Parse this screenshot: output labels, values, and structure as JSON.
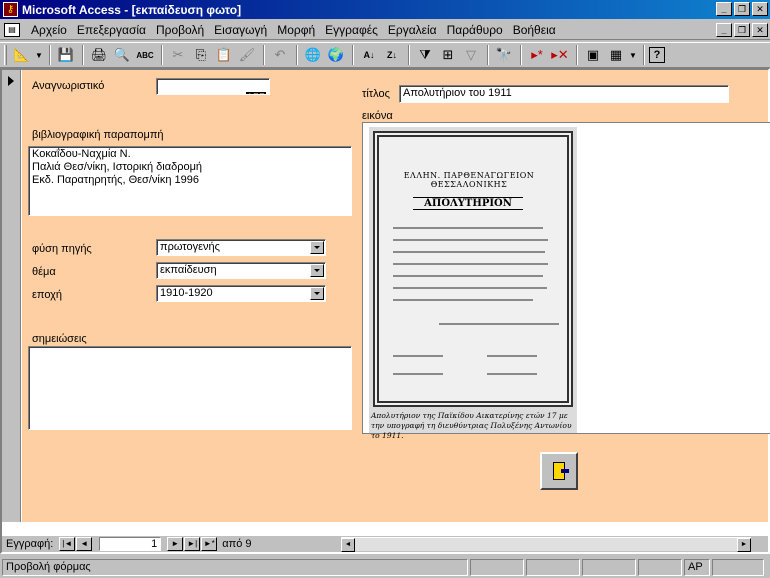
{
  "window": {
    "title": "Microsoft Access - [εκπαίδευση φωτο]",
    "min": "_",
    "restore": "❐",
    "close": "✕"
  },
  "menu": [
    "Αρχείο",
    "Επεξεργασία",
    "Προβολή",
    "Εισαγωγή",
    "Μορφή",
    "Εγγραφές",
    "Εργαλεία",
    "Παράθυρο",
    "Βοήθεια"
  ],
  "toolbar": {
    "icons": [
      "view-design-icon",
      "save-icon",
      "print-icon",
      "print-preview-icon",
      "spelling-icon",
      "cut-icon",
      "copy-icon",
      "paste-icon",
      "format-painter-icon",
      "undo-icon",
      "insert-hyperlink-icon",
      "web-toolbar-icon",
      "sort-ascending-icon",
      "sort-descending-icon",
      "filter-by-selection-icon",
      "filter-by-form-icon",
      "apply-filter-icon",
      "find-icon",
      "new-record-icon",
      "delete-record-icon",
      "database-window-icon",
      "new-object-icon",
      "help-icon"
    ],
    "spelling_label": "ABC"
  },
  "form": {
    "id_label": "Αναγνωριστικό",
    "id_value": "155",
    "title_label": "τίτλος",
    "title_value": "Απολυτήριον του 1911",
    "biblio_label": "βιβλιογραφική παραπομπή",
    "biblio_value": "Κοκαΐδου-Ναχμία Ν.\nΠαλιά Θεσ/νίκη, Ιστορική διαδρομή\nΕκδ. Παρατηρητής, Θεσ/νίκη 1996",
    "source_label": "φύση πηγής",
    "source_value": "πρωτογενής",
    "theme_label": "θέμα",
    "theme_value": "εκπαίδευση",
    "era_label": "εποχή",
    "era_value": "1910-1920",
    "notes_label": "σημειώσεις",
    "notes_value": "",
    "image_label": "εικόνα",
    "photo": {
      "header": "ΕΛΛΗΝ. ΠΑΡΘΕΝΑΓΩΓΕΙΟΝ ΘΕΣΣΑΛΟΝΙΚΗΣ",
      "heading": "ΑΠΟΛΥΤΗΡΙΟΝ",
      "caption": "Απολυτήριον της Παϊκίδου Αικατερίνης ετών 17 με την υπογραφή τη διευθύντριας Πολυξένης Αντωνίου το 1911."
    }
  },
  "nav": {
    "label": "Εγγραφή:",
    "current": "1",
    "total_label": "από 9",
    "first": "|◄",
    "prev": "◄",
    "next": "►",
    "last": "►|",
    "new": "►*"
  },
  "status": {
    "text": "Προβολή φόρμας",
    "cell_ap": "AP"
  }
}
